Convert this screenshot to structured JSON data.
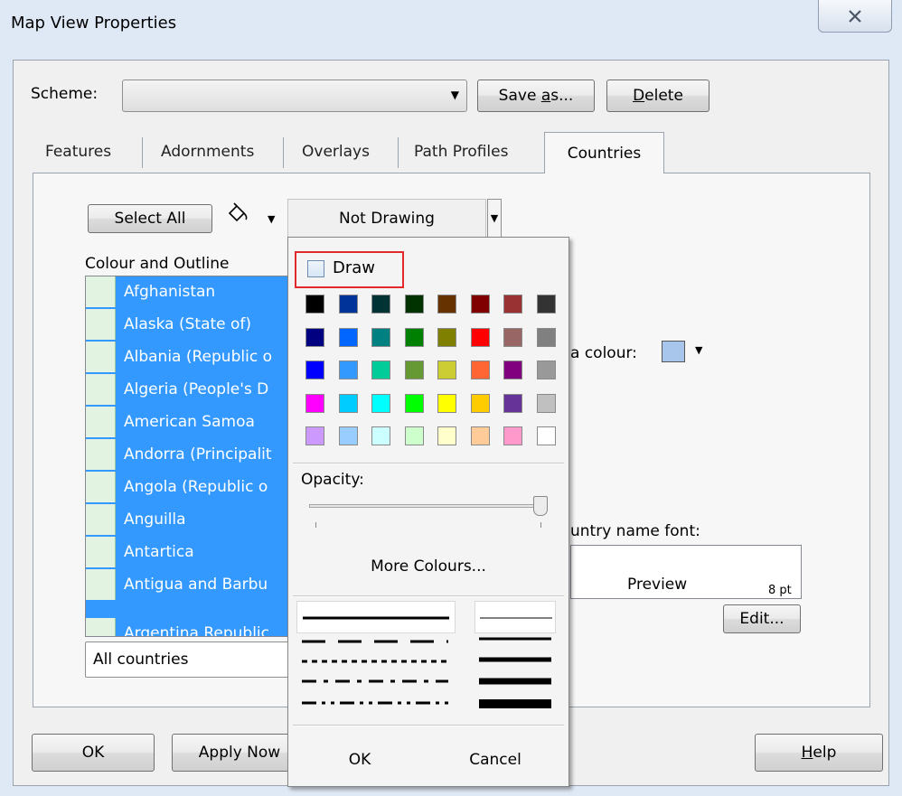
{
  "window": {
    "title": "Map View Properties"
  },
  "scheme": {
    "label": "Scheme:",
    "value": "",
    "save_as": {
      "before": "Save ",
      "key": "a",
      "after": "s..."
    },
    "delete": {
      "key": "D",
      "after": "elete"
    }
  },
  "tabs": [
    {
      "label": "Features",
      "selected": false
    },
    {
      "label": "Adornments",
      "selected": false
    },
    {
      "label": "Overlays",
      "selected": false
    },
    {
      "label": "Path Profiles",
      "selected": false
    },
    {
      "label": "Countries",
      "selected": true
    }
  ],
  "countries_tab": {
    "select_all": "Select All",
    "not_drawing": "Not Drawing",
    "colour_outline_label": "Colour and Outline",
    "countries": [
      "Afghanistan",
      "Alaska (State of)",
      "Albania (Republic o",
      "Algeria (People's D",
      "American Samoa",
      "Andorra (Principalit",
      "Angola (Republic o",
      "Anguilla",
      "Antartica",
      "Antigua and Barbu",
      "Argentina Republic"
    ],
    "filter": "All countries",
    "area_colour_label": "a colour:",
    "area_colour": "#a8c5ec",
    "country_font_label": "untry name font:",
    "preview_text": "Preview",
    "preview_size": "8 pt",
    "edit_button": "Edit..."
  },
  "popup": {
    "draw_label": "Draw",
    "draw_checked": false,
    "palette": [
      [
        "#000000",
        "#003399",
        "#003333",
        "#003300",
        "#663300",
        "#800000",
        "#993333",
        "#333333"
      ],
      [
        "#000080",
        "#0066ff",
        "#008080",
        "#008000",
        "#808000",
        "#ff0000",
        "#996666",
        "#808080"
      ],
      [
        "#0000ff",
        "#3399ff",
        "#00cc99",
        "#669933",
        "#cccc33",
        "#ff6633",
        "#800080",
        "#999999"
      ],
      [
        "#ff00ff",
        "#00ccff",
        "#00ffff",
        "#00ff00",
        "#ffff00",
        "#ffcc00",
        "#663399",
        "#c0c0c0"
      ],
      [
        "#cc99ff",
        "#99ccff",
        "#ccffff",
        "#ccffcc",
        "#ffffcc",
        "#ffcc99",
        "#ff99cc",
        "#ffffff"
      ]
    ],
    "opacity_label": "Opacity:",
    "opacity": 1.0,
    "more_colours": "More Colours...",
    "ok": "OK",
    "cancel": "Cancel"
  },
  "footer": {
    "ok": "OK",
    "apply_now": "Apply Now",
    "help": {
      "key": "H",
      "after": "elp"
    }
  }
}
